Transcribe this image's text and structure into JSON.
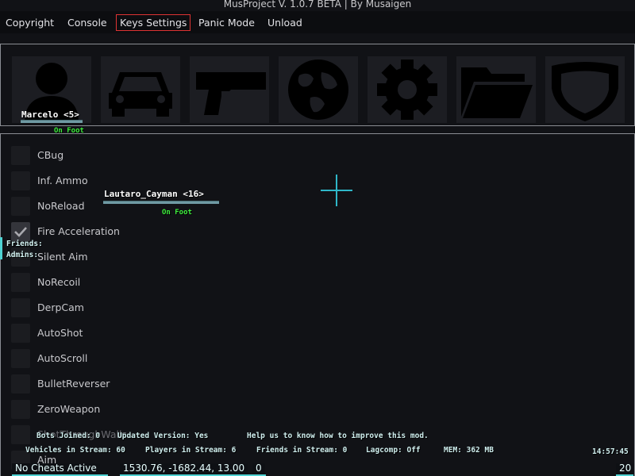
{
  "window": {
    "title": "MusProject V. 1.0.7 BETA | By Musaigen"
  },
  "menu": [
    {
      "label": "Copyright",
      "active": false
    },
    {
      "label": "Console",
      "active": false
    },
    {
      "label": "Keys Settings",
      "active": true
    },
    {
      "label": "Panic Mode",
      "active": false
    },
    {
      "label": "Unload",
      "active": false
    }
  ],
  "category_icons": [
    "player-icon",
    "car-icon",
    "pistol-icon",
    "globe-icon",
    "gear-icon",
    "folder-icon",
    "shield-icon"
  ],
  "options": [
    {
      "label": "CBug",
      "checked": false
    },
    {
      "label": "Inf. Ammo",
      "checked": false
    },
    {
      "label": "NoReload",
      "checked": false
    },
    {
      "label": "Fire Acceleration",
      "checked": true
    },
    {
      "label": "Silent Aim",
      "checked": false
    },
    {
      "label": "NoRecoil",
      "checked": false
    },
    {
      "label": "DerpCam",
      "checked": false
    },
    {
      "label": "AutoShot",
      "checked": false
    },
    {
      "label": "AutoScroll",
      "checked": false
    },
    {
      "label": "BulletReverser",
      "checked": false
    },
    {
      "label": "ZeroWeapon",
      "checked": false
    },
    {
      "label": "ShotThroughWalls",
      "checked": false
    },
    {
      "label": "Aim",
      "checked": false
    }
  ],
  "players": [
    {
      "name": "Marcelo <5>",
      "state": "On Foot"
    },
    {
      "name": "Lautaro_Cayman <16>",
      "state": "On Foot"
    }
  ],
  "sidebar": {
    "friends": "Friends:",
    "admins": "Admins:"
  },
  "status": {
    "bots_joined": "Bots Joined: 0",
    "updated_version": "Updated Version: Yes",
    "help": "Help us to know how to improve this mod.",
    "vehicles": "Vehicles in Stream: 60",
    "players": "Players in Stream: 6",
    "friends": "Friends in Stream: 0",
    "lagcomp": "Lagcomp: Off",
    "mem": "MEM: 362 MB",
    "clock": "14:57:45"
  },
  "hud": {
    "cheats": "No Cheats Active",
    "coords": "1530.76, -1682.44, 13.00",
    "zero": "0",
    "ammo": "20"
  },
  "colors": {
    "accent": "#4fd3d3",
    "active_border": "#dd3333",
    "on_foot": "#3ef03e",
    "crosshair": "#2fb7c9"
  }
}
